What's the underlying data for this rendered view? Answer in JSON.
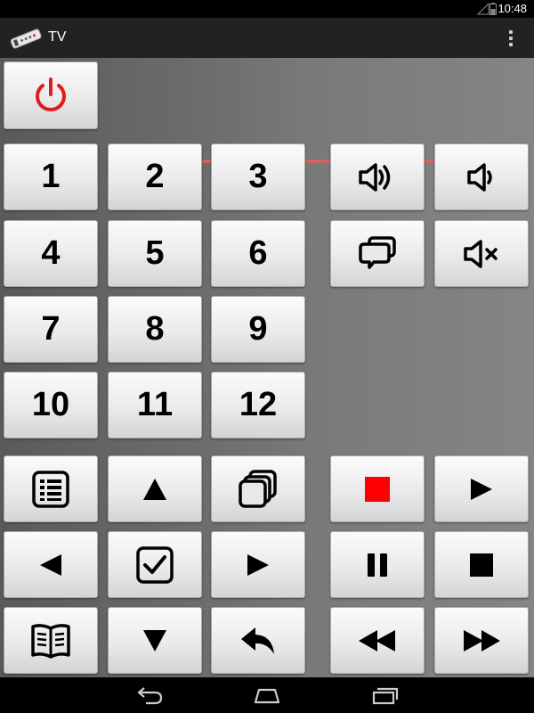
{
  "status_bar": {
    "time": "10:48"
  },
  "action_bar": {
    "title": "TV"
  },
  "colors": {
    "power": "#e01c1c",
    "record": "#ff0000",
    "hint_arrow": "#f05a5a"
  },
  "keypad": {
    "digits": [
      "1",
      "2",
      "3",
      "4",
      "5",
      "6",
      "7",
      "8",
      "9",
      "10",
      "11",
      "12"
    ]
  }
}
